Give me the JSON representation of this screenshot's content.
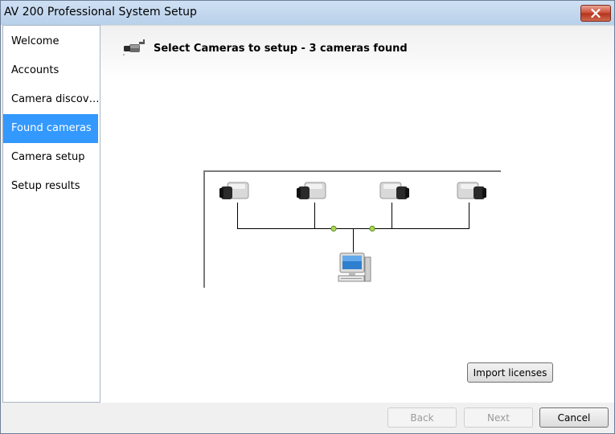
{
  "window": {
    "title": "AV 200 Professional System Setup"
  },
  "sidebar": {
    "items": [
      {
        "label": "Welcome"
      },
      {
        "label": "Accounts"
      },
      {
        "label": "Camera discov…"
      },
      {
        "label": "Found cameras",
        "active": true
      },
      {
        "label": "Camera setup"
      },
      {
        "label": "Setup results"
      }
    ]
  },
  "header": {
    "text": "Select Cameras to setup - 3 cameras found"
  },
  "buttons": {
    "import": "Import licenses",
    "back": "Back",
    "next": "Next",
    "cancel": "Cancel"
  },
  "colors": {
    "accent": "#3399ff",
    "node": "#a8d84e",
    "close": "#c94a33"
  }
}
